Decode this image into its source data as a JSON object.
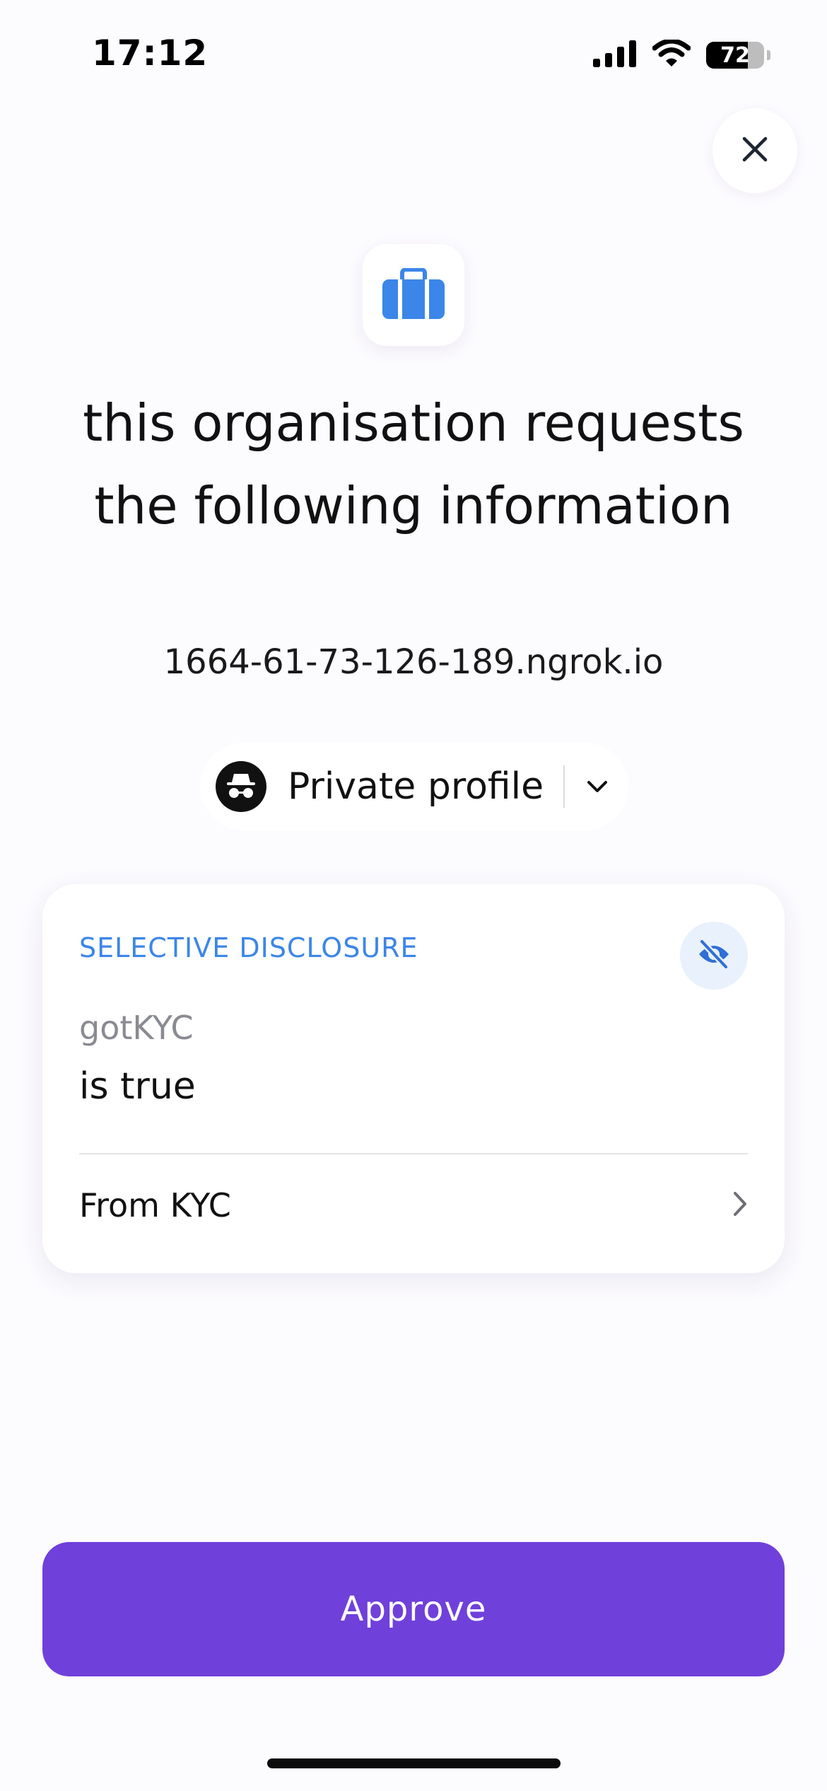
{
  "status_bar": {
    "time": "17:12",
    "battery_percent": "72",
    "battery_level": 0.72
  },
  "header": {
    "close_icon": "close-icon",
    "org_icon": "briefcase-icon",
    "title": "this organisation requests the following information",
    "domain": "1664-61-73-126-189.ngrok.io"
  },
  "profile": {
    "name": "Private profile",
    "avatar_icon": "incognito-icon",
    "chevron_icon": "chevron-down-icon"
  },
  "card": {
    "label": "SELECTIVE DISCLOSURE",
    "visibility_icon": "eye-off-icon",
    "claim_name": "gotKYC",
    "claim_value": "is true",
    "source": "From KYC",
    "source_icon": "chevron-right-icon"
  },
  "actions": {
    "approve_label": "Approve"
  },
  "colors": {
    "accent": "#7040da",
    "link_blue": "#3b86e8",
    "background": "#fcfbfe"
  }
}
